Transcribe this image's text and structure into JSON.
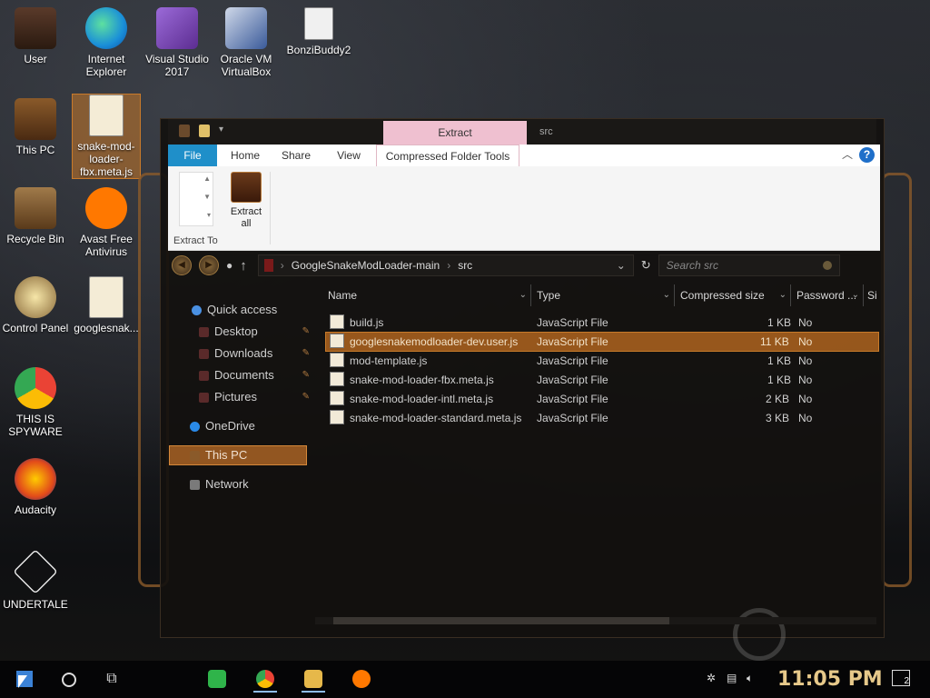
{
  "desktop": {
    "icons": [
      {
        "label": "User"
      },
      {
        "label": "Internet Explorer"
      },
      {
        "label": "Visual Studio 2017"
      },
      {
        "label": "Oracle VM VirtualBox"
      },
      {
        "label": "BonziBuddy2"
      },
      {
        "label": "This PC"
      },
      {
        "label": "snake-mod-loader-fbx.meta.js"
      },
      {
        "label": "Recycle Bin"
      },
      {
        "label": "Avast Free Antivirus"
      },
      {
        "label": "Control Panel"
      },
      {
        "label": "googlesnak..."
      },
      {
        "label": "THIS IS SPYWARE"
      },
      {
        "label": "Audacity"
      },
      {
        "label": "UNDERTALE"
      }
    ]
  },
  "explorer": {
    "title": "src",
    "contextual_tab": "Extract",
    "tabs": {
      "file": "File",
      "home": "Home",
      "share": "Share",
      "view": "View",
      "compressed": "Compressed Folder Tools"
    },
    "help": "?",
    "ribbon": {
      "extract_all": "Extract all",
      "group_label": "Extract To"
    },
    "address": {
      "crumb1": "GoogleSnakeModLoader-main",
      "crumb2": "src"
    },
    "search_placeholder": "Search src",
    "nav": {
      "quick_access": "Quick access",
      "desktop": "Desktop",
      "downloads": "Downloads",
      "documents": "Documents",
      "pictures": "Pictures",
      "onedrive": "OneDrive",
      "this_pc": "This PC",
      "network": "Network"
    },
    "columns": {
      "name": "Name",
      "type": "Type",
      "compressed_size": "Compressed size",
      "password": "Password ...",
      "size": "Si"
    },
    "files": [
      {
        "name": "build.js",
        "type": "JavaScript File",
        "size": "1 KB",
        "password": "No"
      },
      {
        "name": "googlesnakemodloader-dev.user.js",
        "type": "JavaScript File",
        "size": "11 KB",
        "password": "No"
      },
      {
        "name": "mod-template.js",
        "type": "JavaScript File",
        "size": "1 KB",
        "password": "No"
      },
      {
        "name": "snake-mod-loader-fbx.meta.js",
        "type": "JavaScript File",
        "size": "1 KB",
        "password": "No"
      },
      {
        "name": "snake-mod-loader-intl.meta.js",
        "type": "JavaScript File",
        "size": "2 KB",
        "password": "No"
      },
      {
        "name": "snake-mod-loader-standard.meta.js",
        "type": "JavaScript File",
        "size": "3 KB",
        "password": "No"
      }
    ]
  },
  "taskbar": {
    "time": "11:05 PM",
    "notification_count": "2"
  }
}
